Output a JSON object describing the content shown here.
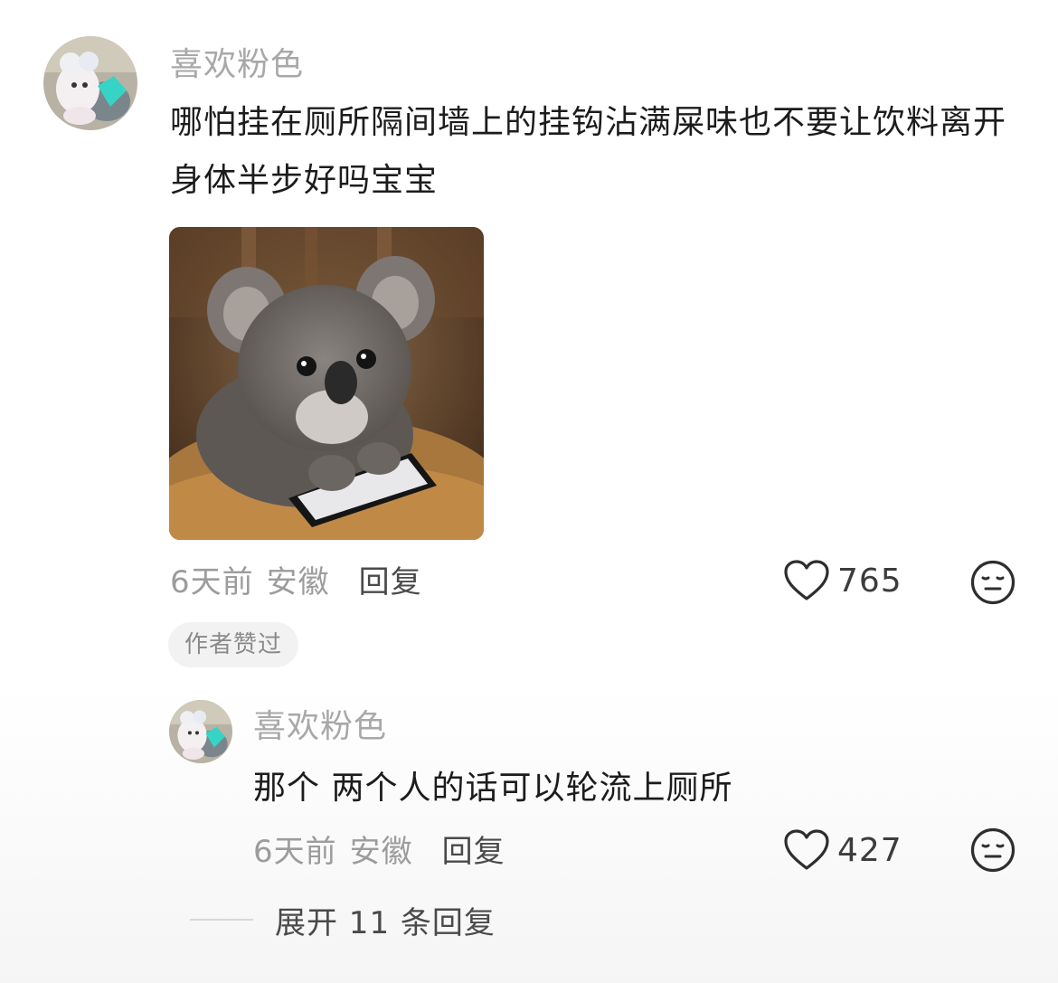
{
  "comment": {
    "username": "喜欢粉色",
    "text": "哪怕挂在厕所隔间墙上的挂钩沾满屎味也不要让饮料离开身体半步好吗宝宝",
    "time": "6天前",
    "location": "安徽",
    "reply_label": "回复",
    "like_count": "765",
    "badge": "作者赞过",
    "avatar_icon": "plush-toy-avatar",
    "sticker_icon": "koala-with-phone-sticker"
  },
  "reply": {
    "username": "喜欢粉色",
    "text": "那个 两个人的话可以轮流上厕所",
    "time": "6天前",
    "location": "安徽",
    "reply_label": "回复",
    "like_count": "427",
    "avatar_icon": "plush-toy-avatar"
  },
  "expand_label": "展开 11 条回复",
  "icons": {
    "like": "heart-outline-icon",
    "dislike": "neutral-face-icon"
  },
  "colors": {
    "username": "#a8a8a8",
    "body_text": "#1c1c1c",
    "meta": "#9c9c9c",
    "badge_bg": "#f2f2f2"
  }
}
